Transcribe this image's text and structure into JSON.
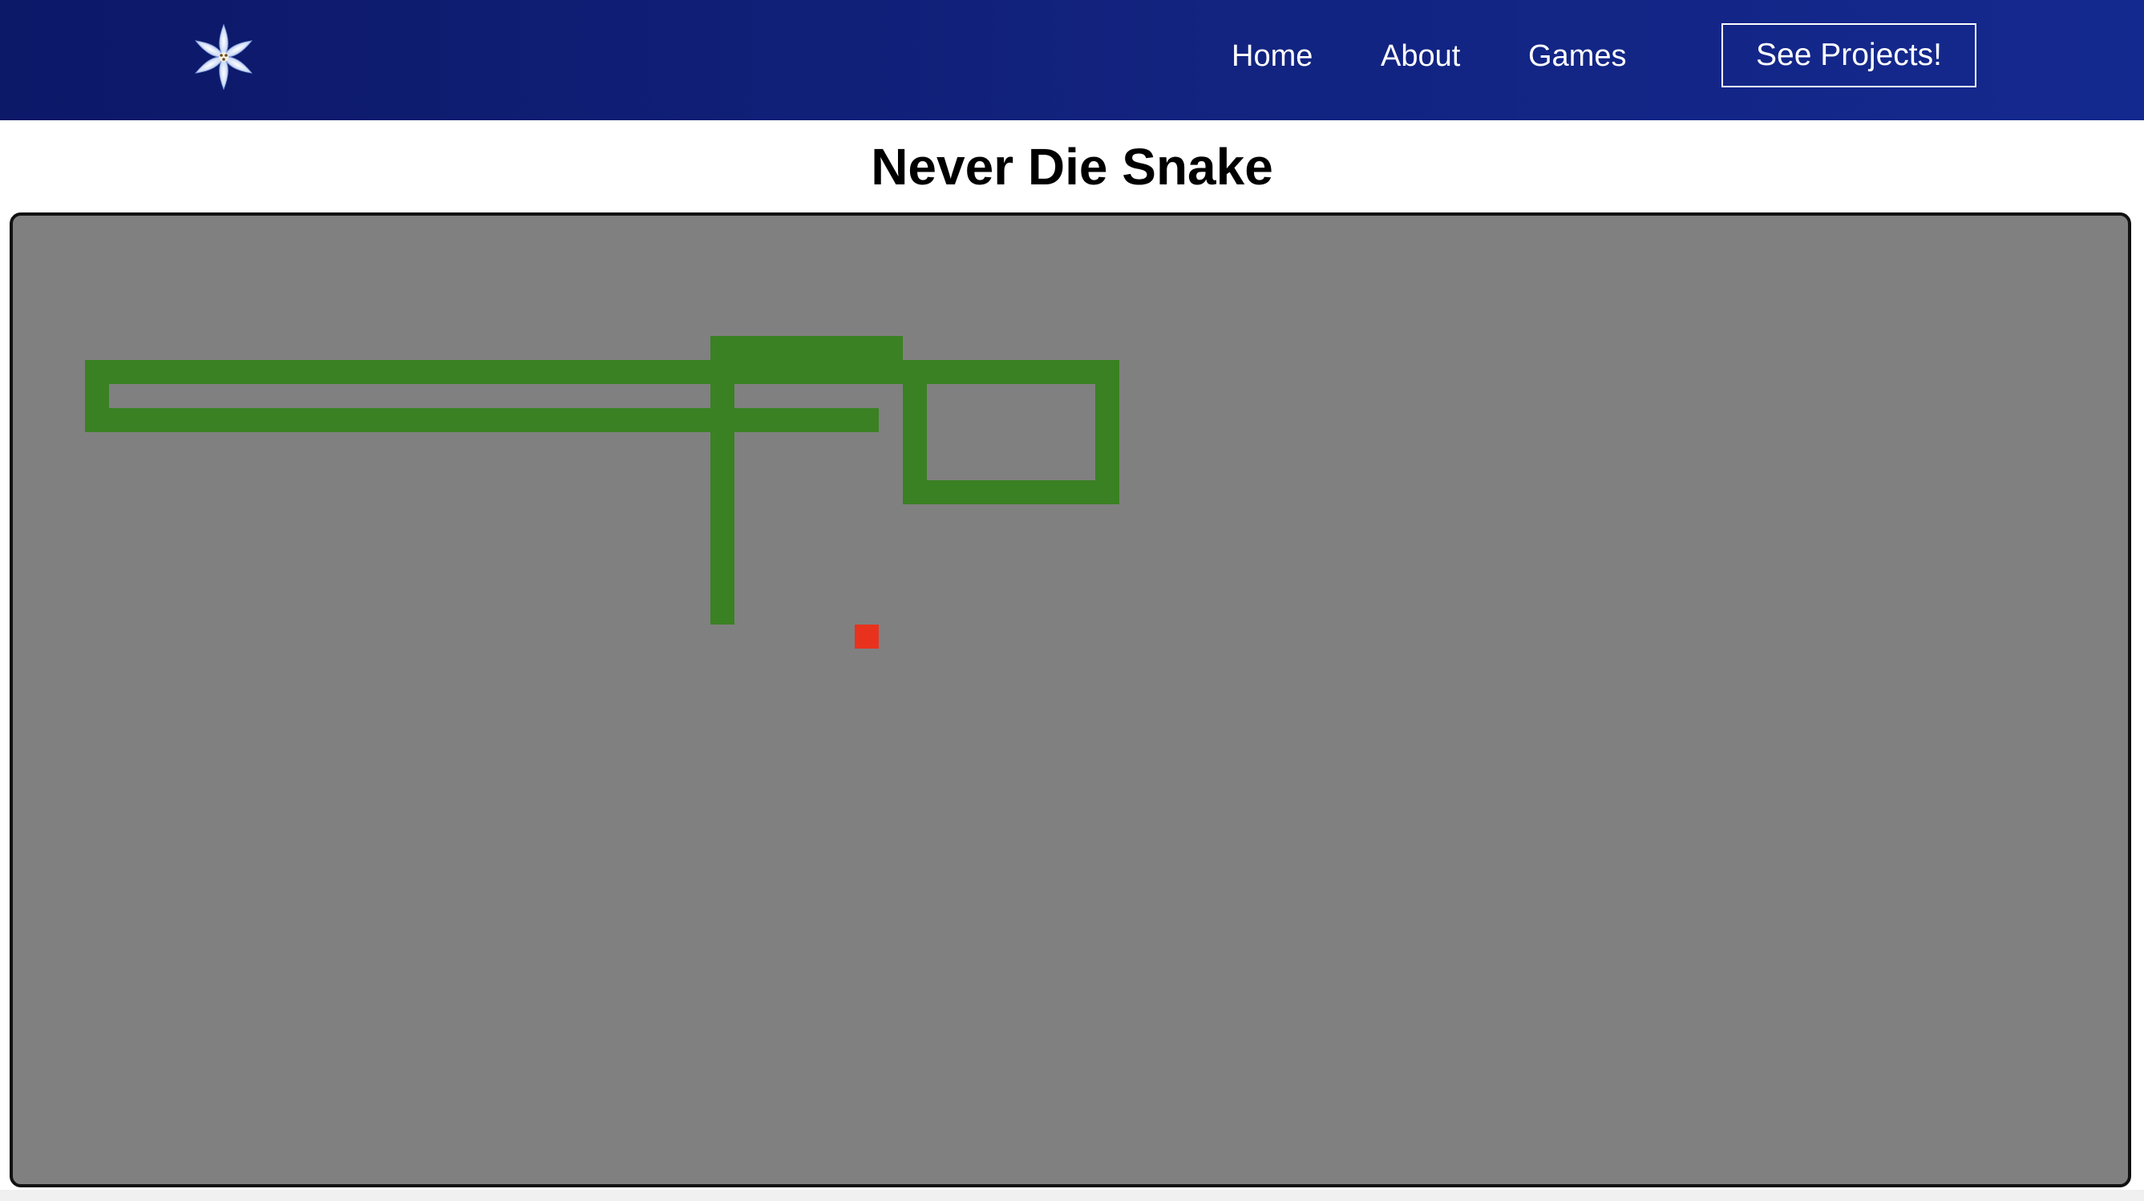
{
  "navbar": {
    "logo_icon": "star-lily-icon",
    "links": [
      {
        "label": "Home"
      },
      {
        "label": "About"
      },
      {
        "label": "Games"
      }
    ],
    "cta_label": "See Projects!",
    "gradient_colors": [
      "#0c1868",
      "#14298f"
    ]
  },
  "game": {
    "title": "Never Die Snake",
    "board_color": "#808080",
    "snake_color": "#3a8123",
    "food_color": "#e8321e",
    "snake_cells": [
      [
        3,
        8
      ],
      [
        4,
        8
      ],
      [
        5,
        8
      ],
      [
        6,
        8
      ],
      [
        7,
        8
      ],
      [
        8,
        8
      ],
      [
        9,
        8
      ],
      [
        10,
        8
      ],
      [
        11,
        8
      ],
      [
        12,
        8
      ],
      [
        13,
        8
      ],
      [
        14,
        8
      ],
      [
        15,
        8
      ],
      [
        16,
        8
      ],
      [
        17,
        8
      ],
      [
        18,
        8
      ],
      [
        19,
        8
      ],
      [
        20,
        8
      ],
      [
        21,
        8
      ],
      [
        22,
        8
      ],
      [
        23,
        8
      ],
      [
        24,
        8
      ],
      [
        25,
        8
      ],
      [
        26,
        8
      ],
      [
        27,
        8
      ],
      [
        28,
        8
      ],
      [
        29,
        8
      ],
      [
        30,
        8
      ],
      [
        31,
        8
      ],
      [
        32,
        8
      ],
      [
        33,
        8
      ],
      [
        34,
        8
      ],
      [
        35,
        8
      ],
      [
        3,
        7
      ],
      [
        3,
        6
      ],
      [
        4,
        6
      ],
      [
        5,
        6
      ],
      [
        6,
        6
      ],
      [
        7,
        6
      ],
      [
        8,
        6
      ],
      [
        9,
        6
      ],
      [
        10,
        6
      ],
      [
        11,
        6
      ],
      [
        12,
        6
      ],
      [
        13,
        6
      ],
      [
        14,
        6
      ],
      [
        15,
        6
      ],
      [
        16,
        6
      ],
      [
        17,
        6
      ],
      [
        18,
        6
      ],
      [
        19,
        6
      ],
      [
        20,
        6
      ],
      [
        21,
        6
      ],
      [
        22,
        6
      ],
      [
        23,
        6
      ],
      [
        24,
        6
      ],
      [
        25,
        6
      ],
      [
        26,
        6
      ],
      [
        27,
        6
      ],
      [
        28,
        6
      ],
      [
        29,
        6
      ],
      [
        30,
        6
      ],
      [
        31,
        6
      ],
      [
        32,
        6
      ],
      [
        33,
        6
      ],
      [
        34,
        6
      ],
      [
        35,
        6
      ],
      [
        36,
        6
      ],
      [
        37,
        6
      ],
      [
        38,
        6
      ],
      [
        39,
        6
      ],
      [
        40,
        6
      ],
      [
        41,
        6
      ],
      [
        42,
        6
      ],
      [
        43,
        6
      ],
      [
        44,
        6
      ],
      [
        45,
        6
      ],
      [
        45,
        7
      ],
      [
        45,
        8
      ],
      [
        45,
        9
      ],
      [
        45,
        10
      ],
      [
        45,
        11
      ],
      [
        44,
        11
      ],
      [
        43,
        11
      ],
      [
        42,
        11
      ],
      [
        41,
        11
      ],
      [
        40,
        11
      ],
      [
        39,
        11
      ],
      [
        38,
        11
      ],
      [
        37,
        11
      ],
      [
        37,
        10
      ],
      [
        37,
        9
      ],
      [
        37,
        8
      ],
      [
        37,
        7
      ],
      [
        37,
        6
      ],
      [
        36,
        5
      ],
      [
        35,
        5
      ],
      [
        34,
        5
      ],
      [
        33,
        5
      ],
      [
        32,
        5
      ],
      [
        31,
        5
      ],
      [
        30,
        5
      ],
      [
        29,
        5
      ],
      [
        29,
        6
      ],
      [
        29,
        7
      ],
      [
        29,
        9
      ],
      [
        29,
        10
      ],
      [
        29,
        11
      ],
      [
        29,
        12
      ],
      [
        29,
        13
      ],
      [
        29,
        14
      ],
      [
        29,
        15
      ],
      [
        29,
        16
      ]
    ],
    "food_cell": [
      35,
      17
    ]
  }
}
